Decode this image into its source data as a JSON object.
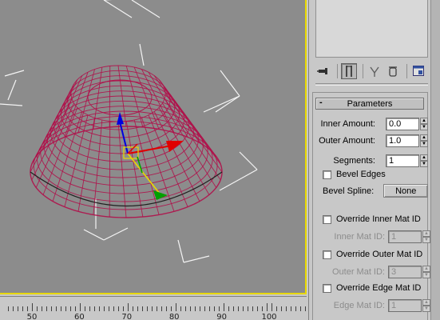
{
  "timeline": {
    "ticks": [
      "50",
      "60",
      "70",
      "80",
      "90",
      "100"
    ]
  },
  "panel": {
    "toolbar": [
      "pin-stack-icon",
      "show-end-result-icon",
      "make-unique-icon",
      "remove-modifier-icon",
      "configure-modifier-sets-icon"
    ],
    "rollout": {
      "title": "Parameters",
      "collapse_symbol": "-",
      "inner_amount": {
        "label": "Inner Amount:",
        "value": "0.0"
      },
      "outer_amount": {
        "label": "Outer Amount:",
        "value": "1.0"
      },
      "segments": {
        "label": "Segments:",
        "value": "1"
      },
      "bevel_edges": {
        "label": "Bevel Edges"
      },
      "bevel_spline": {
        "label": "Bevel Spline:",
        "button": "None"
      },
      "override_inner": {
        "label": "Override Inner Mat ID"
      },
      "inner_mat_id": {
        "label": "Inner Mat ID:",
        "value": "1"
      },
      "override_outer": {
        "label": "Override Outer Mat ID"
      },
      "outer_mat_id": {
        "label": "Outer Mat ID:",
        "value": "3"
      },
      "override_edge": {
        "label": "Override Edge Mat ID"
      },
      "edge_mat_id": {
        "label": "Edge Mat ID:",
        "value": "1"
      }
    }
  },
  "colors": {
    "viewport_bg": "#8c8c8c",
    "active_border": "#e8d800",
    "wireframe": "#b0104a",
    "axis_x": "#e00000",
    "axis_y": "#00a000",
    "axis_z": "#0000e0"
  }
}
